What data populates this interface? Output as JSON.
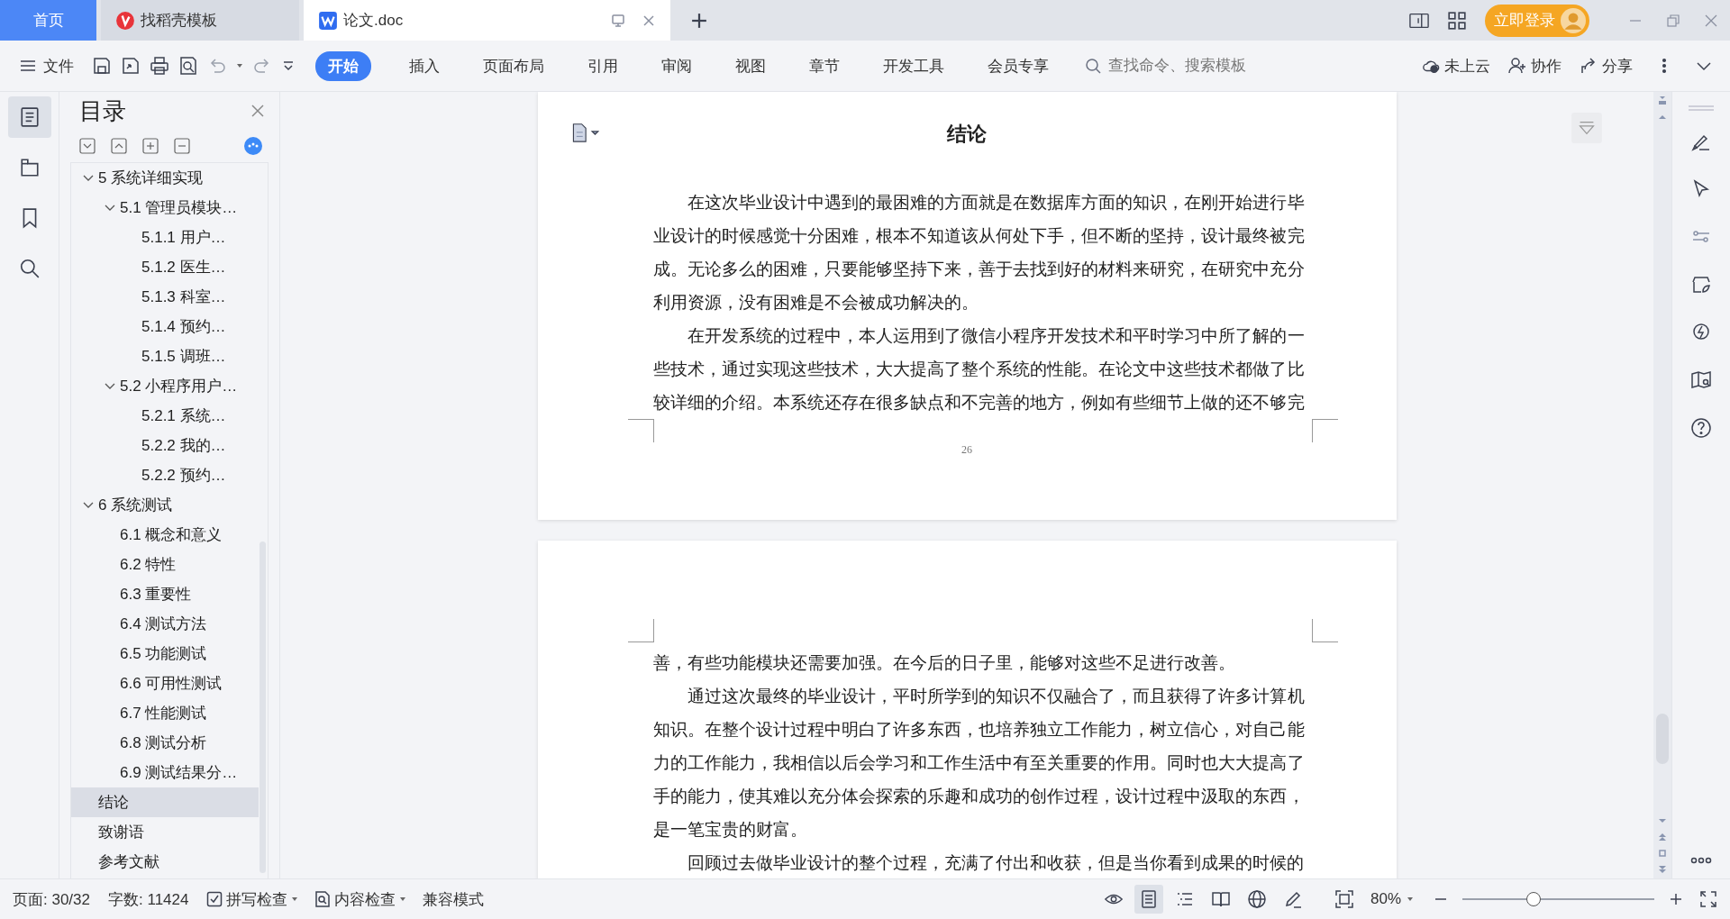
{
  "tabs": [
    {
      "label": "首页",
      "kind": "home",
      "selected": false
    },
    {
      "label": "找稻壳模板",
      "kind": "template",
      "selected": false
    },
    {
      "label": "论文.doc",
      "kind": "doc",
      "selected": true
    }
  ],
  "login_button": "立即登录",
  "toolbar": {
    "file_menu": "文件",
    "ribbon_tabs": [
      {
        "label": "开始",
        "selected": true
      },
      {
        "label": "插入",
        "selected": false
      },
      {
        "label": "页面布局",
        "selected": false
      },
      {
        "label": "引用",
        "selected": false
      },
      {
        "label": "审阅",
        "selected": false
      },
      {
        "label": "视图",
        "selected": false
      },
      {
        "label": "章节",
        "selected": false
      },
      {
        "label": "开发工具",
        "selected": false
      },
      {
        "label": "会员专享",
        "selected": false
      }
    ],
    "search": {
      "placeholder": "查找命令、搜索模板"
    },
    "cloud_status": "未上云",
    "collaborate": "协作",
    "share": "分享"
  },
  "left_rail": [
    {
      "kind": "toc",
      "selected": true
    },
    {
      "kind": "navigation",
      "selected": false
    },
    {
      "kind": "bookmark",
      "selected": false
    },
    {
      "kind": "search",
      "selected": false
    }
  ],
  "toc": {
    "title": "目录",
    "items": [
      {
        "label": "5 系统详细实现",
        "expanded": true,
        "selected": false,
        "children": [
          {
            "label": "5.1  管理员模块…",
            "expanded": true,
            "selected": false,
            "children": [
              {
                "label": "5.1.1  用户…",
                "selected": false
              },
              {
                "label": "5.1.2  医生…",
                "selected": false
              },
              {
                "label": "5.1.3  科室…",
                "selected": false
              },
              {
                "label": "5.1.4  预约…",
                "selected": false
              },
              {
                "label": "5.1.5  调班…",
                "selected": false
              }
            ]
          },
          {
            "label": "5.2  小程序用户…",
            "expanded": true,
            "selected": false,
            "children": [
              {
                "label": "5.2.1  系统…",
                "selected": false
              },
              {
                "label": "5.2.2  我的…",
                "selected": false
              },
              {
                "label": "5.2.2  预约…",
                "selected": false
              }
            ]
          }
        ]
      },
      {
        "label": "6 系统测试",
        "expanded": true,
        "selected": false,
        "children": [
          {
            "label": "6.1 概念和意义",
            "selected": false
          },
          {
            "label": "6.2 特性",
            "selected": false
          },
          {
            "label": "6.3 重要性",
            "selected": false
          },
          {
            "label": "6.4 测试方法",
            "selected": false
          },
          {
            "label": "6.5  功能测试",
            "selected": false
          },
          {
            "label": "6.6 可用性测试",
            "selected": false
          },
          {
            "label": "6.7 性能测试",
            "selected": false
          },
          {
            "label": "6.8 测试分析",
            "selected": false
          },
          {
            "label": "6.9 测试结果分…",
            "selected": false
          }
        ]
      },
      {
        "label": "结论",
        "selected": true
      },
      {
        "label": "致谢语",
        "selected": false
      },
      {
        "label": "参考文献",
        "selected": false
      }
    ]
  },
  "pages": [
    {
      "title": "结论",
      "page_number": "26",
      "paragraphs": [
        {
          "indent": true,
          "text": "在这次毕业设计中遇到的最困难的方面就是在数据库方面的知识，在刚开始进行毕业设计的时候感觉十分困难，根本不知道该从何处下手，但不断的坚持，设计最终被完成。无论多么的困难，只要能够坚持下来，善于去找到好的材料来研究，在研究中充分利用资源，没有困难是不会被成功解决的。"
        },
        {
          "indent": true,
          "text": "在开发系统的过程中，本人运用到了微信小程序开发技术和平时学习中所了解的一些技术，通过实现这些技术，大大提高了整个系统的性能。在论文中这些技术都做了比较详细的介绍。本系统还存在很多缺点和不完善的地方，例如有些细节上做的还不够完"
        }
      ]
    },
    {
      "paragraphs": [
        {
          "indent": false,
          "text": "善，有些功能模块还需要加强。在今后的日子里，能够对这些不足进行改善。"
        },
        {
          "indent": true,
          "text": "通过这次最终的毕业设计，平时所学到的知识不仅融合了，而且获得了许多计算机知识。在整个设计过程中明白了许多东西，也培养独立工作能力，树立信心，对自己能力的工作能力，我相信以后会学习和工作生活中有至关重要的作用。同时也大大提高了手的能力，使其难以充分体会探索的乐趣和成功的创作过程，设计过程中汲取的东西，是一笔宝贵的财富。"
        },
        {
          "indent": true,
          "text": "回顾过去做毕业设计的整个过程，充满了付出和收获，但是当你看到成果的时候的"
        }
      ]
    }
  ],
  "status_bar": {
    "page": "页面: 30/32",
    "word_count": "字数: 11424",
    "spell_check": "拼写检查",
    "content_check": "内容检查",
    "mode": "兼容模式",
    "view_modes": [
      {
        "kind": "page",
        "selected": true
      },
      {
        "kind": "outline",
        "selected": false
      },
      {
        "kind": "read",
        "selected": false
      },
      {
        "kind": "web",
        "selected": false
      },
      {
        "kind": "write",
        "selected": false
      }
    ],
    "zoom": "80%",
    "zoom_slider": {
      "level": 0.37
    }
  }
}
